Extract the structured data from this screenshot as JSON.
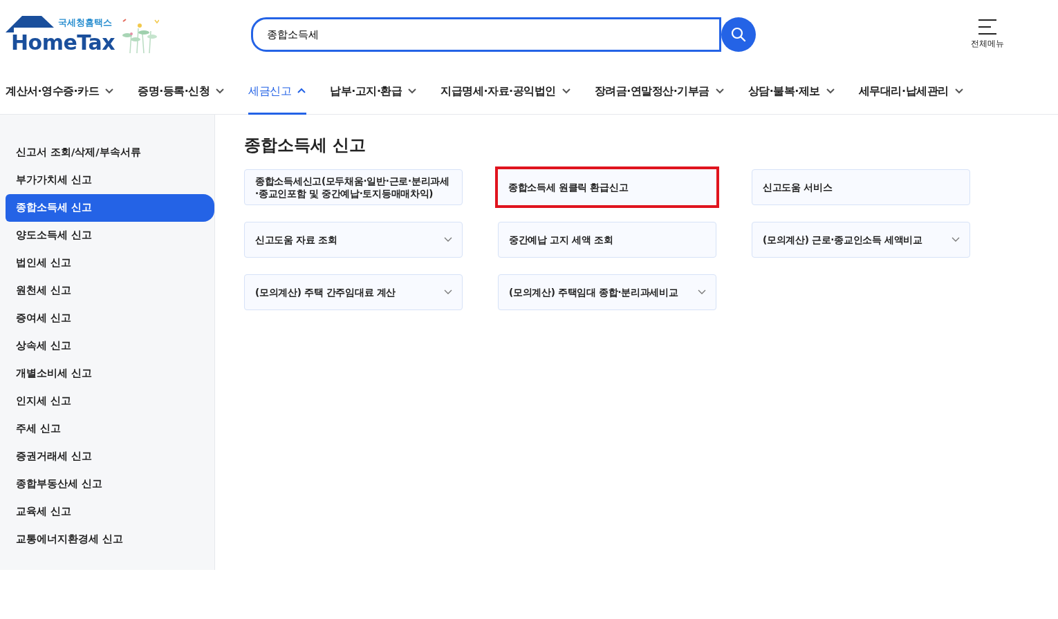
{
  "logo": {
    "subtitle": "국세청홈택스",
    "name": "HomeTax"
  },
  "search": {
    "value": "종합소득세"
  },
  "menu_button": {
    "label": "전체메뉴"
  },
  "nav": [
    {
      "label": "계산서·영수증·카드",
      "selected": false
    },
    {
      "label": "증명·등록·신청",
      "selected": false
    },
    {
      "label": "세금신고",
      "selected": true
    },
    {
      "label": "납부·고지·환급",
      "selected": false
    },
    {
      "label": "지급명세·자료·공익법인",
      "selected": false
    },
    {
      "label": "장려금·연말정산·기부금",
      "selected": false
    },
    {
      "label": "상담·불복·제보",
      "selected": false
    },
    {
      "label": "세무대리·납세관리",
      "selected": false
    }
  ],
  "sidebar": {
    "items": [
      {
        "label": "신고서 조회/삭제/부속서류",
        "selected": false
      },
      {
        "label": "부가가치세 신고",
        "selected": false
      },
      {
        "label": "종합소득세 신고",
        "selected": true
      },
      {
        "label": "양도소득세 신고",
        "selected": false
      },
      {
        "label": "법인세 신고",
        "selected": false
      },
      {
        "label": "원천세 신고",
        "selected": false
      },
      {
        "label": "증여세 신고",
        "selected": false
      },
      {
        "label": "상속세 신고",
        "selected": false
      },
      {
        "label": "개별소비세 신고",
        "selected": false
      },
      {
        "label": "인지세 신고",
        "selected": false
      },
      {
        "label": "주세 신고",
        "selected": false
      },
      {
        "label": "증권거래세 신고",
        "selected": false
      },
      {
        "label": "종합부동산세 신고",
        "selected": false
      },
      {
        "label": "교육세 신고",
        "selected": false
      },
      {
        "label": "교통에너지환경세 신고",
        "selected": false
      }
    ]
  },
  "content": {
    "title": "종합소득세 신고",
    "cards": [
      {
        "label": "종합소득세신고(모두채움·일반·근로·분리과세·종교인포함 및 중간예납·토지등매매차익)",
        "dropdown": false,
        "highlighted": false
      },
      {
        "label": "종합소득세 원클릭 환급신고",
        "dropdown": false,
        "highlighted": true
      },
      {
        "label": "신고도움 서비스",
        "dropdown": false,
        "highlighted": false
      },
      {
        "label": "신고도움 자료 조회",
        "dropdown": true,
        "highlighted": false
      },
      {
        "label": "중간예납 고지 세액 조회",
        "dropdown": false,
        "highlighted": false
      },
      {
        "label": "(모의계산) 근로·종교인소득 세액비교",
        "dropdown": true,
        "highlighted": false
      },
      {
        "label": "(모의계산) 주택 간주임대료 계산",
        "dropdown": true,
        "highlighted": false
      },
      {
        "label": "(모의계산) 주택임대 종합·분리과세비교",
        "dropdown": true,
        "highlighted": false
      }
    ]
  }
}
